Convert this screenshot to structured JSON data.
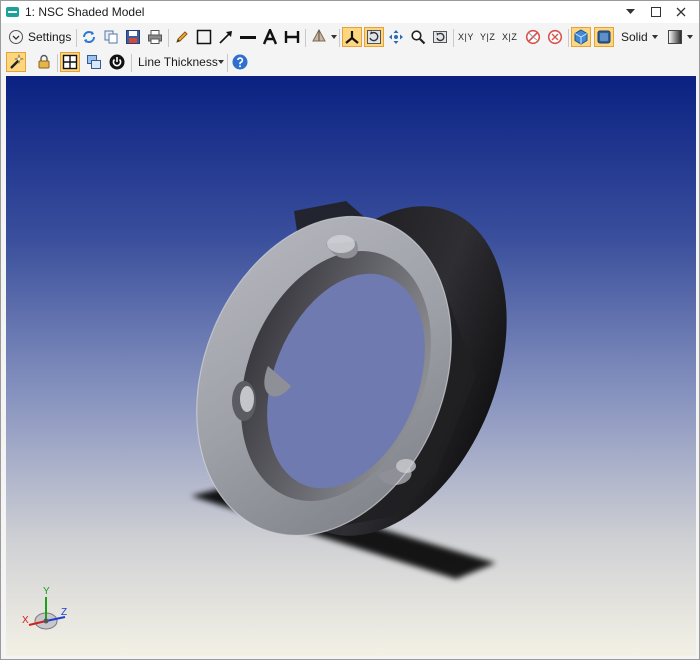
{
  "window": {
    "title": "1: NSC Shaded Model"
  },
  "toolbar1": {
    "settings_label": "Settings",
    "axis_xy": "X|Y",
    "axis_yz": "Y|Z",
    "axis_xz": "X|Z",
    "solid_label": "Solid"
  },
  "toolbar2": {
    "line_thickness_label": "Line Thickness"
  },
  "axes": {
    "x": "X",
    "y": "Y",
    "z": "Z"
  },
  "colors": {
    "accent_active": "#fcd77f",
    "help_blue": "#2f6fd0",
    "viewport_top": "#0a2182",
    "viewport_bottom": "#f3f1e5"
  }
}
